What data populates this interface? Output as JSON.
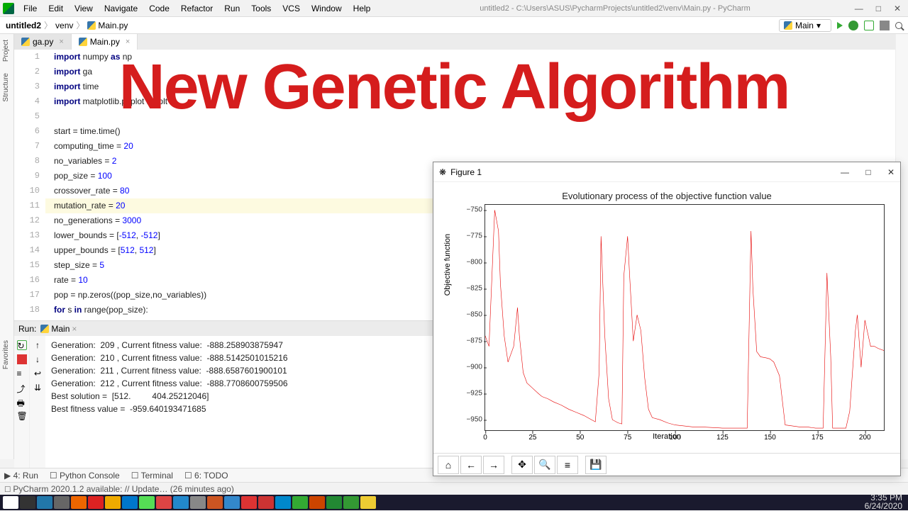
{
  "window": {
    "title_path": "untitled2 - C:\\Users\\ASUS\\PycharmProjects\\untitled2\\venv\\Main.py - PyCharm"
  },
  "menu": [
    "File",
    "Edit",
    "View",
    "Navigate",
    "Code",
    "Refactor",
    "Run",
    "Tools",
    "VCS",
    "Window",
    "Help"
  ],
  "breadcrumbs": {
    "project": "untitled2",
    "folder": "venv",
    "file": "Main.py"
  },
  "run_config": "Main",
  "left_tools": [
    "Project",
    "Structure",
    "Favorites"
  ],
  "tabs": [
    {
      "name": "ga.py",
      "active": false
    },
    {
      "name": "Main.py",
      "active": true
    }
  ],
  "code_lines": [
    "import numpy as np",
    "import ga",
    "import time",
    "import matplotlib.pyplot as plt",
    "",
    "start = time.time()",
    "computing_time = 20",
    "no_variables = 2",
    "pop_size = 100",
    "crossover_rate = 80",
    "mutation_rate = 20",
    "no_generations = 3000",
    "lower_bounds = [-512, -512]",
    "upper_bounds = [512, 512]",
    "step_size = 5",
    "rate = 10",
    "pop = np.zeros((pop_size,no_variables))",
    "for s in range(pop_size):"
  ],
  "run_panel": {
    "label": "Run:",
    "config": "Main"
  },
  "console_output": [
    "Generation:  209 , Current fitness value:  -888.258903875947",
    "Generation:  210 , Current fitness value:  -888.5142501015216",
    "Generation:  211 , Current fitness value:  -888.6587601900101",
    "Generation:  212 , Current fitness value:  -888.7708600759506",
    "Best solution =  [512.         404.25212046]",
    "Best fitness value =  -959.640193471685"
  ],
  "bottom_tabs": [
    "4: Run",
    "Python Console",
    "Terminal",
    "6: TODO"
  ],
  "status_bar": "PyCharm 2020.1.2 available: // Update… (26 minutes ago)",
  "overlay": "New Genetic Algorithm",
  "figure": {
    "title": "Figure 1",
    "toolbar": [
      "home",
      "back",
      "forward",
      "pan",
      "zoom",
      "config",
      "save"
    ]
  },
  "clock": {
    "time": "3:35 PM",
    "date": "6/24/2020"
  },
  "chart_data": {
    "type": "line",
    "title": "Evolutionary process of the objective function value",
    "xlabel": "Iteration",
    "ylabel": "Objective function",
    "xlim": [
      0,
      210
    ],
    "ylim": [
      -960,
      -745
    ],
    "xticks": [
      0,
      25,
      50,
      75,
      100,
      125,
      150,
      175,
      200
    ],
    "yticks": [
      -750,
      -775,
      -800,
      -825,
      -850,
      -875,
      -900,
      -925,
      -950
    ],
    "x": [
      0,
      2,
      5,
      7,
      8,
      10,
      12,
      15,
      17,
      18,
      20,
      22,
      25,
      28,
      30,
      33,
      36,
      40,
      44,
      48,
      52,
      56,
      58,
      60,
      61,
      63,
      65,
      67,
      70,
      72,
      73,
      75,
      76,
      78,
      80,
      82,
      84,
      86,
      88,
      92,
      96,
      100,
      105,
      110,
      115,
      125,
      135,
      138,
      140,
      141,
      143,
      145,
      148,
      150,
      152,
      155,
      158,
      162,
      166,
      170,
      174,
      178,
      180,
      182,
      183,
      185,
      187,
      190,
      192,
      195,
      196,
      198,
      200,
      203,
      205,
      207,
      210
    ],
    "values": [
      -870,
      -880,
      -750,
      -770,
      -820,
      -870,
      -895,
      -880,
      -843,
      -870,
      -905,
      -915,
      -920,
      -925,
      -928,
      -930,
      -933,
      -936,
      -940,
      -943,
      -946,
      -950,
      -952,
      -905,
      -775,
      -870,
      -930,
      -950,
      -953,
      -954,
      -813,
      -775,
      -810,
      -875,
      -850,
      -865,
      -910,
      -940,
      -948,
      -950,
      -953,
      -955,
      -956,
      -957,
      -957,
      -958,
      -958,
      -958,
      -770,
      -825,
      -885,
      -890,
      -891,
      -892,
      -895,
      -908,
      -955,
      -956,
      -957,
      -957,
      -958,
      -958,
      -810,
      -890,
      -958,
      -958,
      -958,
      -958,
      -942,
      -865,
      -850,
      -900,
      -855,
      -880,
      -880,
      -882,
      -884
    ]
  }
}
